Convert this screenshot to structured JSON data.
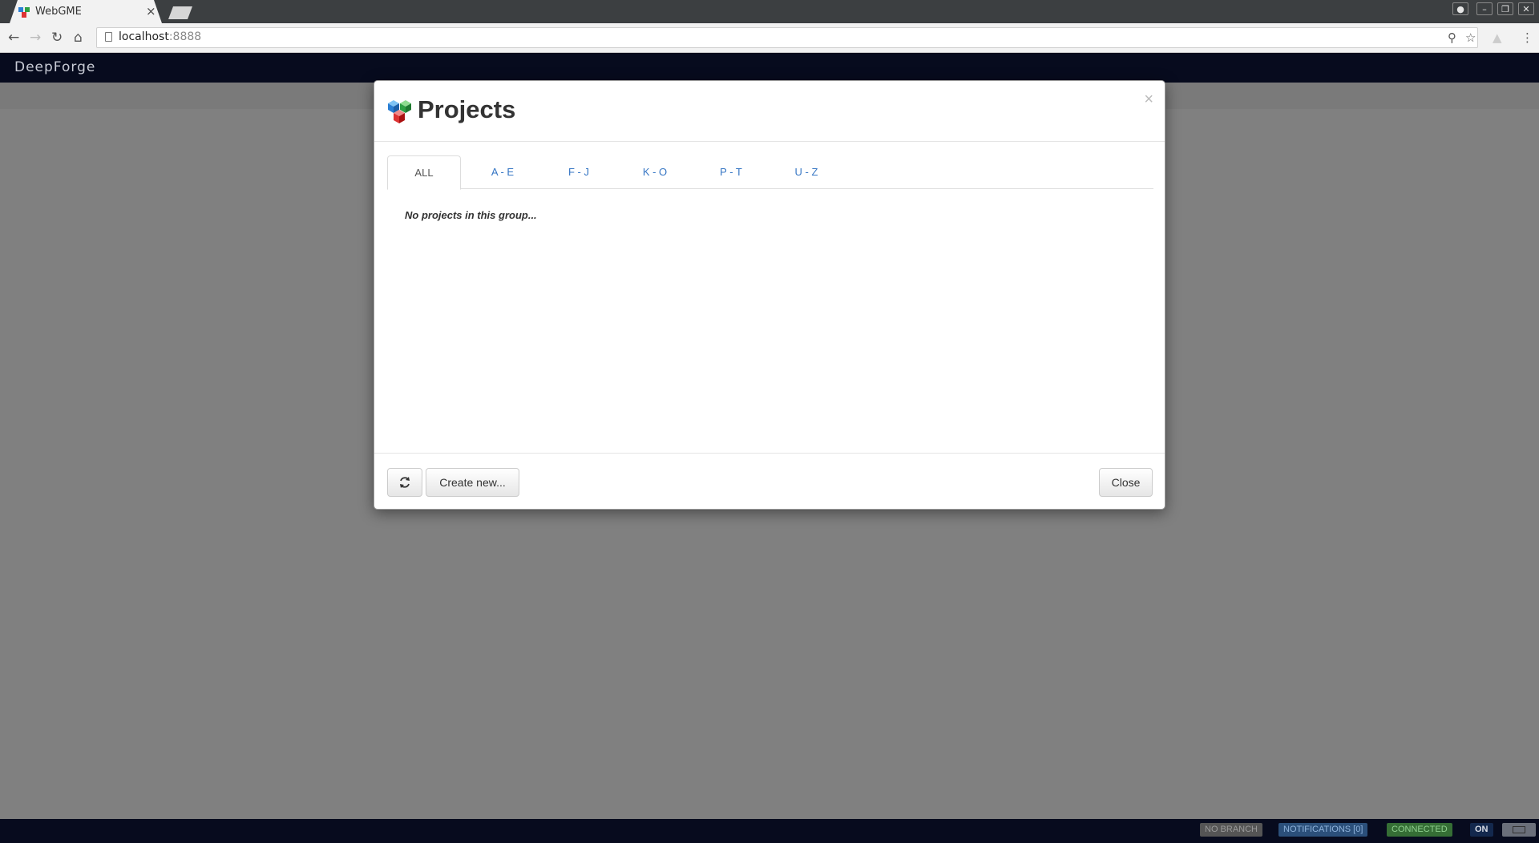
{
  "browser": {
    "tab_title": "WebGME",
    "tab_close": "×",
    "url_host": "localhost",
    "url_port": ":8888",
    "window_buttons": [
      "user-icon",
      "minimize-icon",
      "restore-icon",
      "close-icon"
    ]
  },
  "app": {
    "brand": "DeepForge"
  },
  "modal": {
    "title": "Projects",
    "close_glyph": "×",
    "tabs": [
      {
        "label": "ALL",
        "active": true
      },
      {
        "label": "A - E",
        "active": false
      },
      {
        "label": "F - J",
        "active": false
      },
      {
        "label": "K - O",
        "active": false
      },
      {
        "label": "P - T",
        "active": false
      },
      {
        "label": "U - Z",
        "active": false
      }
    ],
    "empty_message": "No projects in this group...",
    "footer": {
      "refresh_icon": "refresh-icon",
      "create_label": "Create new...",
      "close_label": "Close"
    }
  },
  "status": {
    "branch": "NO BRANCH",
    "notifications": "NOTIFICATIONS [0]",
    "connection": "CONNECTED",
    "keyboard": "ON"
  },
  "colors": {
    "header_bg": "#070b1e",
    "link": "#3676c4",
    "connected": "#5cb85c",
    "notifications": "#337ab7"
  }
}
